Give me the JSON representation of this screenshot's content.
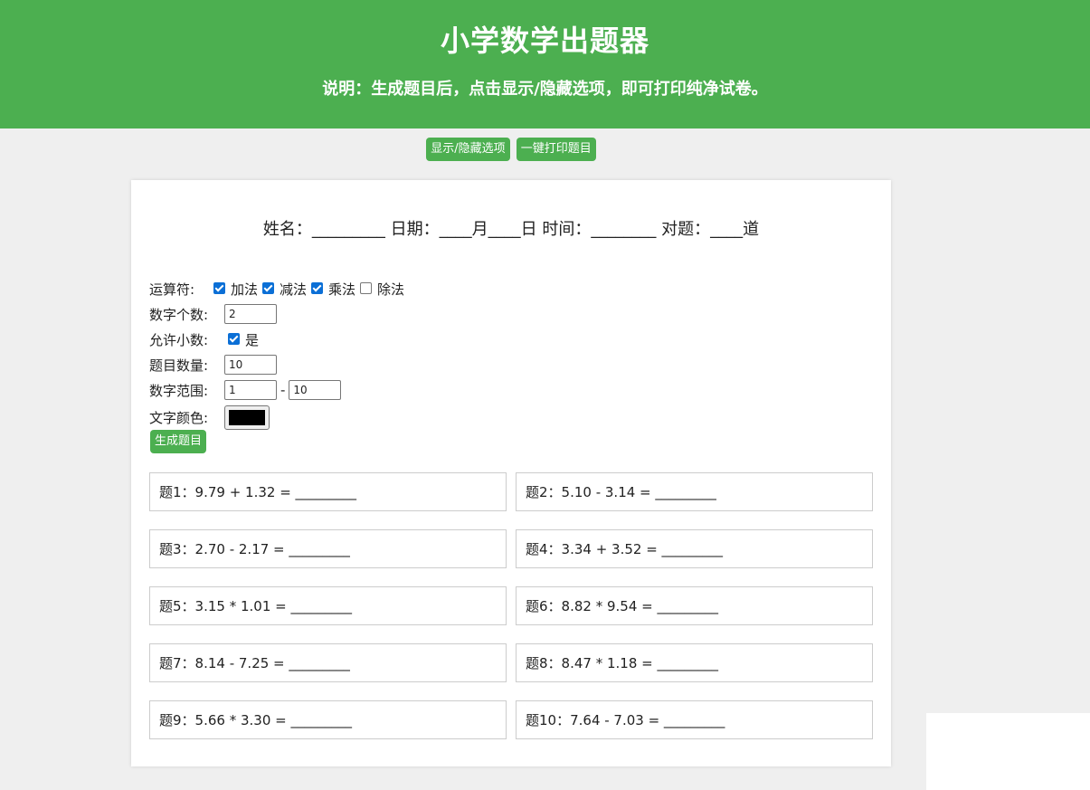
{
  "header": {
    "title": "小学数学出题器",
    "description": "说明：生成题目后，点击显示/隐藏选项，即可打印纯净试卷。"
  },
  "toolbar": {
    "toggle_label": "显示/隐藏选项",
    "print_label": "一键打印题目"
  },
  "sheet_header": "姓名：_________ 日期：____月____日 时间：________ 对题：____道",
  "options": {
    "operators_label": "运算符:",
    "operators": [
      {
        "label": "加法",
        "checked": true
      },
      {
        "label": "减法",
        "checked": true
      },
      {
        "label": "乘法",
        "checked": true
      },
      {
        "label": "除法",
        "checked": false
      }
    ],
    "count_label": "数字个数:",
    "count_value": "2",
    "decimal_label": "允许小数:",
    "decimal_option": "是",
    "decimal_checked": true,
    "quantity_label": "题目数量:",
    "quantity_value": "10",
    "range_label": "数字范围:",
    "range_min": "1",
    "range_sep": "-",
    "range_max": "10",
    "color_label": "文字颜色:",
    "color_value": "#000000",
    "generate_label": "生成题目"
  },
  "questions": [
    "题1：9.79 + 1.32 = _________",
    "题2：5.10 - 3.14 = _________",
    "题3：2.70 - 2.17 = _________",
    "题4：3.34 + 3.52 = _________",
    "题5：3.15 * 1.01 = _________",
    "题6：8.82 * 9.54 = _________",
    "题7：8.14 - 7.25 = _________",
    "题8：8.47 * 1.18 = _________",
    "题9：5.66 * 3.30 = _________",
    "题10：7.64 - 7.03 = _________"
  ],
  "colors": {
    "accent": "#4caf50",
    "checkbox": "#0b6fd6",
    "background": "#efefef"
  }
}
